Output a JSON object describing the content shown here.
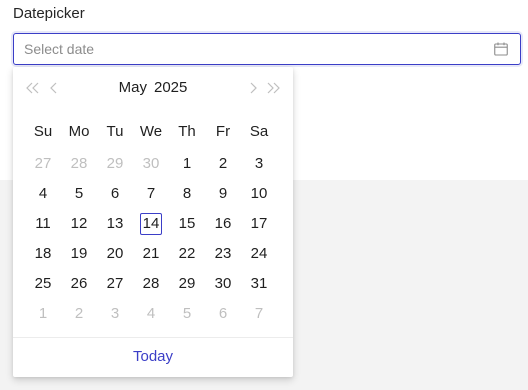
{
  "field": {
    "label": "Datepicker",
    "value": "",
    "placeholder": "Select date",
    "icon": "calendar-icon"
  },
  "calendar": {
    "month": "May",
    "year": "2025",
    "nav": {
      "super_prev_icon": "double-chevron-left-icon",
      "prev_icon": "chevron-left-icon",
      "next_icon": "chevron-right-icon",
      "super_next_icon": "double-chevron-right-icon"
    },
    "weekdays": [
      "Su",
      "Mo",
      "Tu",
      "We",
      "Th",
      "Fr",
      "Sa"
    ],
    "weeks": [
      [
        {
          "d": "27",
          "out": true
        },
        {
          "d": "28",
          "out": true
        },
        {
          "d": "29",
          "out": true
        },
        {
          "d": "30",
          "out": true
        },
        {
          "d": "1"
        },
        {
          "d": "2"
        },
        {
          "d": "3"
        }
      ],
      [
        {
          "d": "4"
        },
        {
          "d": "5"
        },
        {
          "d": "6"
        },
        {
          "d": "7"
        },
        {
          "d": "8"
        },
        {
          "d": "9"
        },
        {
          "d": "10"
        }
      ],
      [
        {
          "d": "11"
        },
        {
          "d": "12"
        },
        {
          "d": "13"
        },
        {
          "d": "14",
          "today": true
        },
        {
          "d": "15"
        },
        {
          "d": "16"
        },
        {
          "d": "17"
        }
      ],
      [
        {
          "d": "18"
        },
        {
          "d": "19"
        },
        {
          "d": "20"
        },
        {
          "d": "21"
        },
        {
          "d": "22"
        },
        {
          "d": "23"
        },
        {
          "d": "24"
        }
      ],
      [
        {
          "d": "25"
        },
        {
          "d": "26"
        },
        {
          "d": "27"
        },
        {
          "d": "28"
        },
        {
          "d": "29"
        },
        {
          "d": "30"
        },
        {
          "d": "31"
        }
      ],
      [
        {
          "d": "1",
          "out": true
        },
        {
          "d": "2",
          "out": true
        },
        {
          "d": "3",
          "out": true
        },
        {
          "d": "4",
          "out": true
        },
        {
          "d": "5",
          "out": true
        },
        {
          "d": "6",
          "out": true
        },
        {
          "d": "7",
          "out": true
        }
      ]
    ],
    "today_label": "Today"
  },
  "colors": {
    "accent": "#3b3ec7",
    "text": "#1f1f1f",
    "muted_text": "#bfbfbf",
    "placeholder": "#8c8c8c",
    "backdrop": "#f3f3f3"
  }
}
